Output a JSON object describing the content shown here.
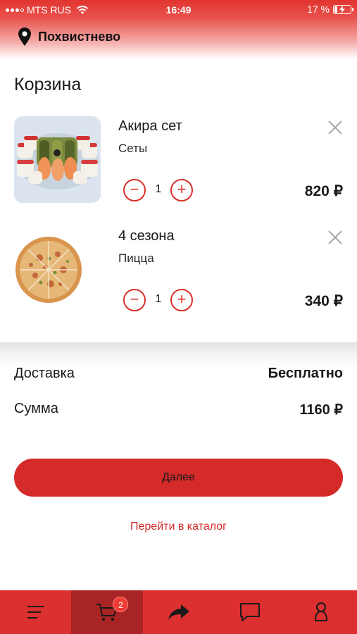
{
  "status_bar": {
    "carrier": "MTS RUS",
    "time": "16:49",
    "battery": "17 %",
    "battery_level": 0.17
  },
  "header": {
    "city": "Похвистнево"
  },
  "page": {
    "title": "Корзина"
  },
  "cart": {
    "items": [
      {
        "name": "Акира сет",
        "category": "Сеты",
        "quantity": "1",
        "price": "820 ₽",
        "minus": "−",
        "plus": "+"
      },
      {
        "name": "4 сезона",
        "category": "Пицца",
        "quantity": "1",
        "price": "340 ₽",
        "minus": "−",
        "plus": "+"
      }
    ]
  },
  "summary": {
    "delivery_label": "Доставка",
    "delivery_value": "Бесплатно",
    "total_label": "Сумма",
    "total_value": "1160 ₽"
  },
  "actions": {
    "next_label": "Далее",
    "catalog_link": "Перейти в каталог"
  },
  "bottom_nav": {
    "cart_badge": "2",
    "tabs": [
      "menu-icon",
      "cart-icon",
      "share-icon",
      "chat-icon",
      "profile-icon"
    ],
    "active_tab": "cart-icon"
  },
  "colors": {
    "accent": "#d42a2a",
    "nav_background": "#dc2f2f",
    "nav_active": "#a92424"
  }
}
